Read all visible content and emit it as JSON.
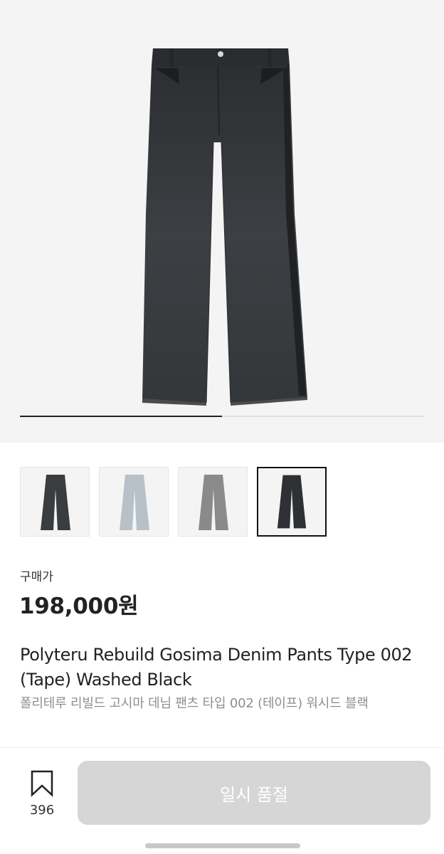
{
  "product": {
    "gallery": {
      "current_index": 1,
      "total": 2
    },
    "thumbnails": [
      {
        "colorway": "washed black",
        "color": "#3a3d40",
        "selected": false
      },
      {
        "colorway": "light blue",
        "color": "#b8c0c8",
        "selected": false
      },
      {
        "colorway": "grey",
        "color": "#8a8a8a",
        "selected": false
      },
      {
        "colorway": "washed black",
        "color": "#2e3033",
        "selected": true
      }
    ],
    "price_label": "구매가",
    "price": "198,000원",
    "title_en": "Polyteru Rebuild Gosima Denim Pants Type 002 (Tape) Washed Black",
    "title_ko": "폴리테루 리빌드 고시마 데님 팬츠 타입 002 (테이프) 워시드 블랙"
  },
  "bottom_bar": {
    "wish_icon": "bookmark-icon",
    "wish_count": "396",
    "buy_button_label": "일시 품절"
  },
  "colors": {
    "background": "#ffffff",
    "hero_background": "#f4f4f4",
    "button_disabled": "#d6d6d6",
    "text_primary": "#222222",
    "text_secondary": "#8e8e8e"
  }
}
